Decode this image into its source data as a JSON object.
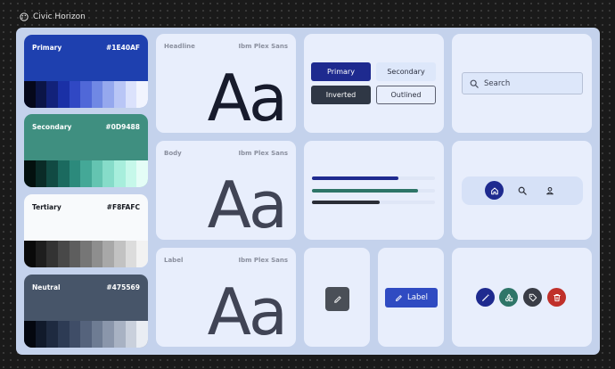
{
  "app": {
    "title": "Civic Horizon"
  },
  "colors": {
    "primary": {
      "label": "Primary",
      "hex": "#1E40AF",
      "tones": [
        "#05081a",
        "#0b1547",
        "#12227a",
        "#1a30a6",
        "#3048c4",
        "#5068d8",
        "#7088e4",
        "#95a8ee",
        "#b9c6f6",
        "#dbe2fc",
        "#f1f4fe"
      ]
    },
    "secondary": {
      "label": "Secondary",
      "hex": "#0D9488",
      "tones": [
        "#03100e",
        "#0a2b27",
        "#114a43",
        "#1b6a5f",
        "#2c8a7c",
        "#44a897",
        "#64c4b1",
        "#86dcc9",
        "#a7eedc",
        "#c6f8ea",
        "#e4fdf6"
      ]
    },
    "tertiary": {
      "label": "Tertiary",
      "hex": "#F8FAFC",
      "tones": [
        "#0a0a0a",
        "#1e1e1e",
        "#333333",
        "#484848",
        "#5e5e5e",
        "#767676",
        "#8e8e8e",
        "#a8a8a8",
        "#c2c2c2",
        "#dcdcdc",
        "#f2f2f2"
      ]
    },
    "neutral": {
      "label": "Neutral",
      "hex": "#475569",
      "tones": [
        "#04070f",
        "#111a2b",
        "#1e2a40",
        "#2d3b54",
        "#3f4d67",
        "#55637c",
        "#6e7c93",
        "#8a96ab",
        "#a8b2c3",
        "#c9d0dc",
        "#e9edf3"
      ]
    }
  },
  "typography": [
    {
      "role": "Headline",
      "font": "Ibm Plex Sans",
      "sample": "Aa",
      "color": "#171b2c"
    },
    {
      "role": "Body",
      "font": "Ibm Plex Sans",
      "sample": "Aa",
      "color": "#404455"
    },
    {
      "role": "Label",
      "font": "Ibm Plex Sans",
      "sample": "Aa",
      "color": "#404455"
    }
  ],
  "buttons": {
    "primary": "Primary",
    "secondary": "Secondary",
    "inverted": "Inverted",
    "outlined": "Outlined"
  },
  "search": {
    "placeholder": "Search"
  },
  "progress": [
    {
      "value": 0.7,
      "color": "#1e2a8f"
    },
    {
      "value": 0.86,
      "color": "#2e7568"
    },
    {
      "value": 0.55,
      "color": "#2a2d36"
    }
  ],
  "nav": {
    "items": [
      "home-icon",
      "search-icon",
      "person-icon"
    ],
    "active": 0
  },
  "fab": {
    "icon": "pencil-icon"
  },
  "chip": {
    "label": "Label",
    "icon": "pencil-icon"
  },
  "icon_buttons": [
    {
      "icon": "magic-wand-icon",
      "color": "#1e2a8f"
    },
    {
      "icon": "shapes-icon",
      "color": "#2e7568"
    },
    {
      "icon": "tag-icon",
      "color": "#3a3d46"
    },
    {
      "icon": "trash-icon",
      "color": "#c0302a"
    }
  ]
}
